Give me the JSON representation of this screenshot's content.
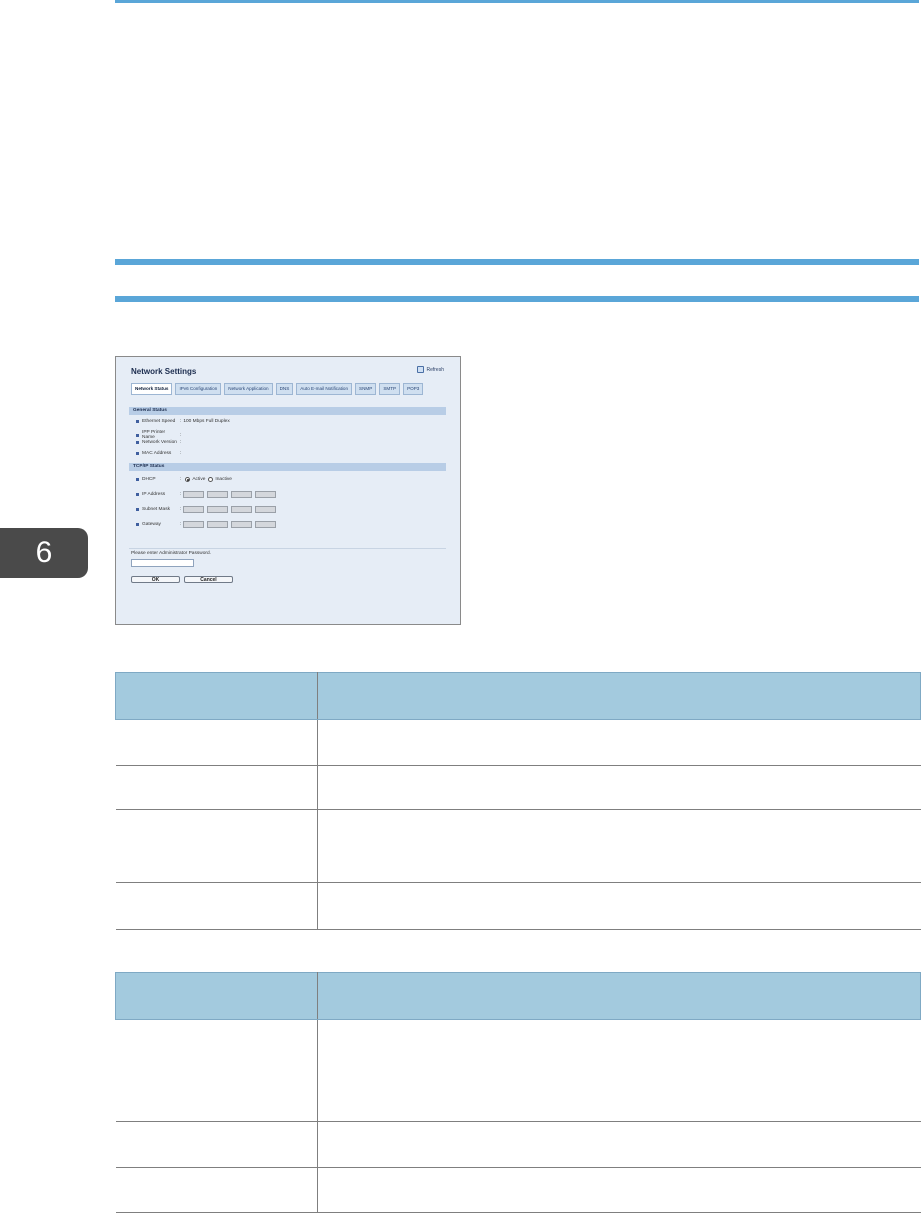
{
  "chapter": {
    "number": "6"
  },
  "screenshot": {
    "title": "Network Settings",
    "refresh_label": "Refresh",
    "tabs": [
      "Network Status",
      "IPv6 Configuration",
      "Network Application",
      "DNS",
      "Auto E-mail Notification",
      "SNMP",
      "SMTP",
      "POP3"
    ],
    "active_tab": "Network Status",
    "general_status": {
      "heading": "General Status",
      "ethernet_speed_label": "Ethernet Speed",
      "ethernet_speed_value": "100 Mbps Full Duplex",
      "ipp_printer_name_label": "IPP Printer Name",
      "network_version_label": "Network Version",
      "mac_address_label": "MAC Address"
    },
    "tcpip_status": {
      "heading": "TCP/IP Status",
      "dhcp_label": "DHCP",
      "dhcp_active": "Active",
      "dhcp_inactive": "Inactive",
      "ip_address_label": "IP Address",
      "subnet_mask_label": "Subnet Mask",
      "gateway_label": "Gateway"
    },
    "password_prompt": "Please enter Administrator Password.",
    "ok_label": "OK",
    "cancel_label": "Cancel"
  }
}
